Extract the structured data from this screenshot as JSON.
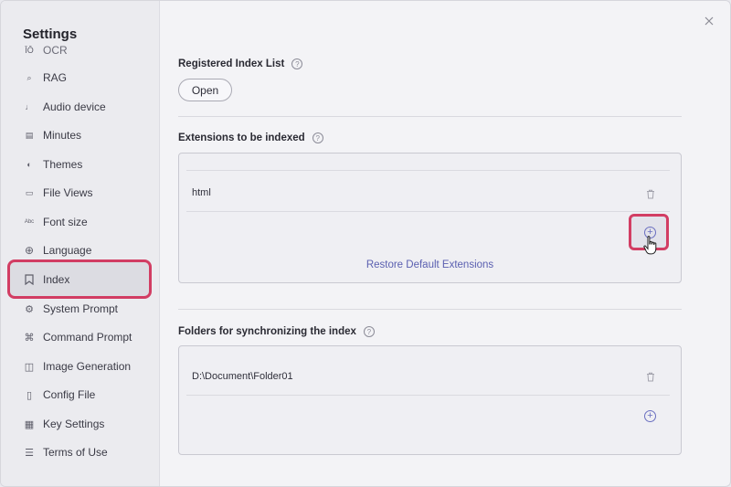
{
  "sidebar": {
    "title": "Settings",
    "items": [
      {
        "label": "OCR",
        "icon": "ocr-icon",
        "glyph": "ĪŌ"
      },
      {
        "label": "RAG",
        "icon": "search-icon",
        "glyph": "⌕"
      },
      {
        "label": "Audio device",
        "icon": "microphone-icon",
        "glyph": "♩"
      },
      {
        "label": "Minutes",
        "icon": "document-icon",
        "glyph": "▤"
      },
      {
        "label": "Themes",
        "icon": "palette-icon",
        "glyph": "◐"
      },
      {
        "label": "File Views",
        "icon": "folder-icon",
        "glyph": "▭"
      },
      {
        "label": "Font size",
        "icon": "font-size-icon",
        "glyph": "Abc"
      },
      {
        "label": "Language",
        "icon": "globe-icon",
        "glyph": "⊕"
      },
      {
        "label": "Index",
        "icon": "bookmark-icon",
        "glyph": "⎕"
      },
      {
        "label": "System Prompt",
        "icon": "system-prompt-icon",
        "glyph": "⚙"
      },
      {
        "label": "Command Prompt",
        "icon": "command-icon",
        "glyph": "⌘"
      },
      {
        "label": "Image Generation",
        "icon": "image-icon",
        "glyph": "◫"
      },
      {
        "label": "Config File",
        "icon": "config-file-icon",
        "glyph": "▯"
      },
      {
        "label": "Key Settings",
        "icon": "key-icon",
        "glyph": "▦"
      },
      {
        "label": "Terms of Use",
        "icon": "terms-icon",
        "glyph": "☰"
      }
    ],
    "active_item": "Index"
  },
  "main": {
    "registered_index": {
      "title": "Registered Index List",
      "open_label": "Open"
    },
    "extensions": {
      "title": "Extensions to be indexed",
      "items": [
        "html"
      ],
      "restore_label": "Restore Default Extensions"
    },
    "folders": {
      "title": "Folders for synchronizing the index",
      "items": [
        "D:\\Document\\Folder01"
      ]
    }
  },
  "colors": {
    "accent": "#6a6fc0",
    "highlight": "#d23d63"
  }
}
